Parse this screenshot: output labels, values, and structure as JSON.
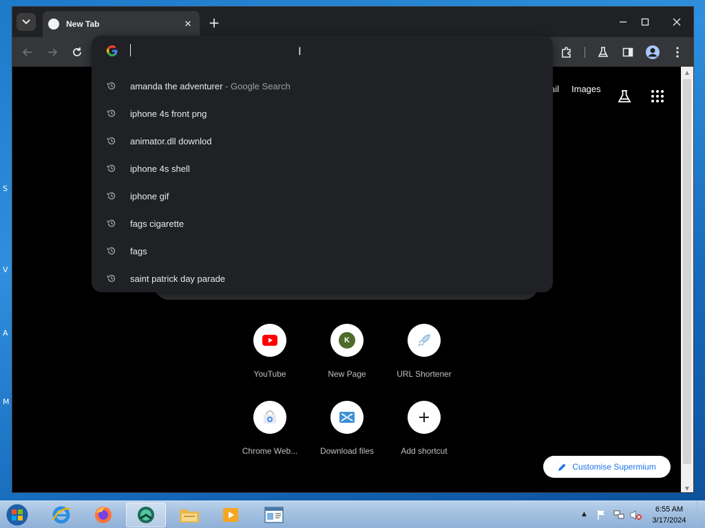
{
  "browser": {
    "tab": {
      "title": "New Tab"
    },
    "omnibox": {
      "value": "",
      "suggestions": [
        {
          "text": "amanda the adventurer",
          "desc": " - Google Search"
        },
        {
          "text": "iphone 4s front png",
          "desc": ""
        },
        {
          "text": "animator.dll downlod",
          "desc": ""
        },
        {
          "text": "iphone 4s shell",
          "desc": ""
        },
        {
          "text": "iphone gif",
          "desc": ""
        },
        {
          "text": "fags cigarette",
          "desc": ""
        },
        {
          "text": "fags",
          "desc": ""
        },
        {
          "text": "saint patrick day parade",
          "desc": ""
        }
      ]
    }
  },
  "newtab": {
    "top_links": {
      "gmail": "ail",
      "images": "Images"
    },
    "shortcuts": [
      {
        "label": "YouTube",
        "icon": "youtube-icon"
      },
      {
        "label": "New Page",
        "icon": "k-avatar-icon",
        "letter": "K"
      },
      {
        "label": "URL Shortener",
        "icon": "rocket-icon"
      },
      {
        "label": "Chrome Web...",
        "icon": "chrome-web-store-icon"
      },
      {
        "label": "Download files",
        "icon": "download-files-icon"
      },
      {
        "label": "Add shortcut",
        "icon": "plus-icon"
      }
    ],
    "customise_label": "Customise Supermium"
  },
  "taskbar": {
    "time": "6:55 AM",
    "date": "3/17/2024"
  },
  "colors": {
    "youtube_red": "#ff0000",
    "customise_blue": "#1a73e8",
    "k_avatar": "#4e6b2b"
  }
}
